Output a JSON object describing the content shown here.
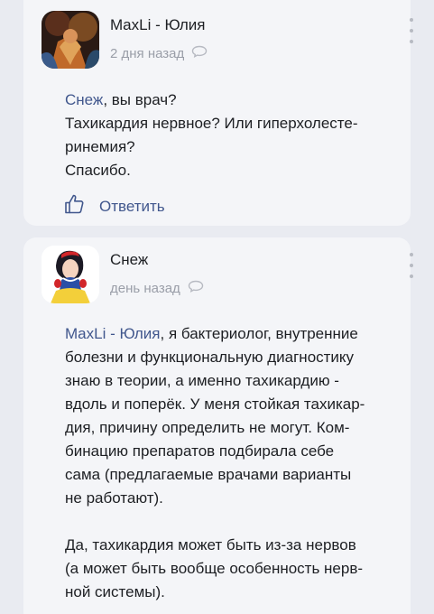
{
  "comments": [
    {
      "author": "MaxLi - Юлия",
      "time": "2 дня назад",
      "mention": "Снеж",
      "lines": [
        ", вы врач?",
        "Тахикардия нервное? Или гиперхолесте-",
        "ринемия?",
        "Спасибо."
      ],
      "reply_label": "Ответить"
    },
    {
      "author": "Снеж",
      "time": "день назад",
      "mention": "MaxLi - Юлия",
      "p1_first": ", я бактериолог, внутренние",
      "p1_lines": [
        "болезни и функциональную диагностику",
        "знаю в теории, а именно тахикардию -",
        "вдоль и поперёк. У меня стойкая тахикар-",
        "дия, причину определить не могут. Ком-",
        "бинацию препаратов подбирала себе",
        "сама (предлагаемые врачами варианты",
        "не работают)."
      ],
      "p2_lines": [
        "Да, тахикардия может быть из-за нервов",
        "(а может быть вообще особенность нерв-",
        "ной системы)."
      ]
    }
  ],
  "icons": {
    "like": "thumbs-up-icon",
    "comment": "speech-bubble-icon",
    "more": "more-vertical-icon"
  },
  "colors": {
    "accent": "#41578d",
    "meta": "#9a9ea8",
    "card": "#f4f5f8",
    "background": "#e9ebf1"
  }
}
